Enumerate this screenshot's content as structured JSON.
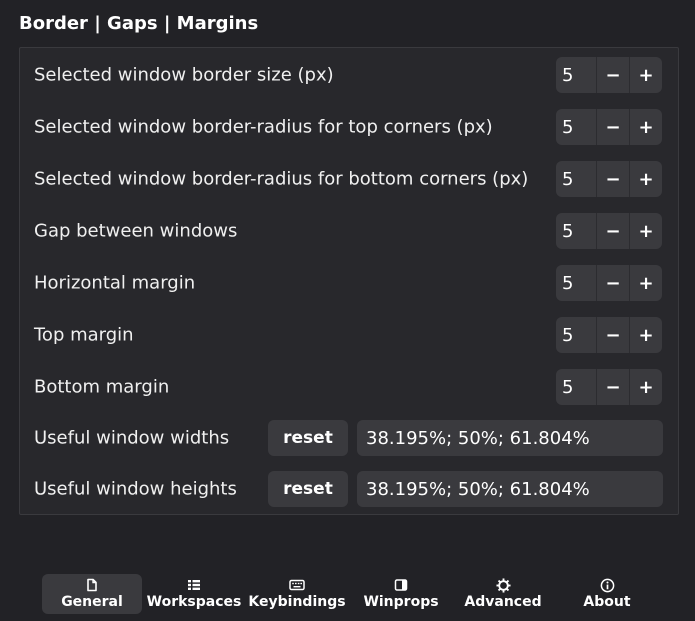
{
  "page": {
    "title": "Border | Gaps | Margins"
  },
  "settings": {
    "rows": [
      {
        "label": "Selected window border size (px)",
        "value": "5",
        "decrement": "−",
        "increment": "+"
      },
      {
        "label": "Selected window border-radius for top corners (px)",
        "value": "5",
        "decrement": "−",
        "increment": "+"
      },
      {
        "label": "Selected window border-radius for bottom corners (px)",
        "value": "5",
        "decrement": "−",
        "increment": "+"
      },
      {
        "label": "Gap between windows",
        "value": "5",
        "decrement": "−",
        "increment": "+"
      },
      {
        "label": "Horizontal margin",
        "value": "5",
        "decrement": "−",
        "increment": "+"
      },
      {
        "label": "Top margin",
        "value": "5",
        "decrement": "−",
        "increment": "+"
      },
      {
        "label": "Bottom margin",
        "value": "5",
        "decrement": "−",
        "increment": "+"
      }
    ],
    "useful_widths": {
      "label": "Useful window widths",
      "reset_label": "reset",
      "value": "38.195%; 50%; 61.804%"
    },
    "useful_heights": {
      "label": "Useful window heights",
      "reset_label": "reset",
      "value": "38.195%; 50%; 61.804%"
    }
  },
  "nav": {
    "active": "General",
    "items": [
      {
        "label": "General",
        "icon": "document-icon"
      },
      {
        "label": "Workspaces",
        "icon": "list-icon"
      },
      {
        "label": "Keybindings",
        "icon": "keyboard-icon"
      },
      {
        "label": "Winprops",
        "icon": "window-icon"
      },
      {
        "label": "Advanced",
        "icon": "gear-icon"
      },
      {
        "label": "About",
        "icon": "info-icon"
      }
    ]
  },
  "colors": {
    "background": "#222226",
    "group_background": "#28282c",
    "control_background": "#3a3a3e",
    "text": "#ffffff"
  }
}
